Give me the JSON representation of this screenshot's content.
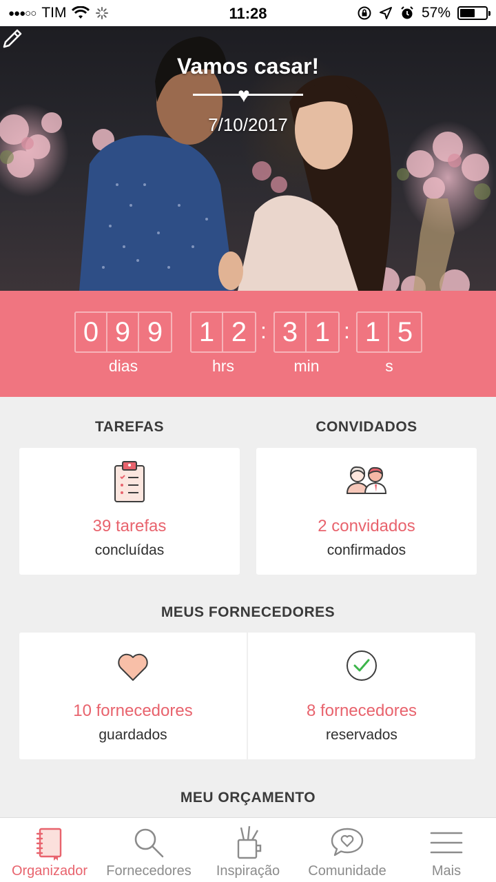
{
  "status_bar": {
    "signal": "●●●○○",
    "carrier": "TIM",
    "time": "11:28",
    "battery_percent": "57%",
    "battery_level": 0.57
  },
  "hero": {
    "title": "Vamos casar!",
    "date": "7/10/2017",
    "edit_icon": "pencil-icon"
  },
  "countdown": {
    "days": [
      "0",
      "9",
      "9"
    ],
    "hours": [
      "1",
      "2"
    ],
    "minutes": [
      "3",
      "1"
    ],
    "seconds": [
      "1",
      "5"
    ],
    "separator": ":",
    "labels": {
      "days": "dias",
      "hours": "hrs",
      "minutes": "min",
      "seconds": "s"
    },
    "background": "#f07580"
  },
  "tasks": {
    "title": "TAREFAS",
    "main": "39 tarefas",
    "sub": "concluídas",
    "icon": "clipboard-icon"
  },
  "guests": {
    "title": "CONVIDADOS",
    "main": "2 convidados",
    "sub": "confirmados",
    "icon": "people-icon"
  },
  "vendors": {
    "title": "MEUS FORNECEDORES",
    "saved": {
      "main": "10 fornecedores",
      "sub": "guardados",
      "icon": "heart-icon"
    },
    "booked": {
      "main": "8 fornecedores",
      "sub": "reservados",
      "icon": "check-circle-icon"
    }
  },
  "budget": {
    "title": "MEU ORÇAMENTO"
  },
  "tab_bar": {
    "items": [
      {
        "label": "Organizador",
        "icon": "notebook-icon",
        "active": true
      },
      {
        "label": "Fornecedores",
        "icon": "search-icon",
        "active": false
      },
      {
        "label": "Inspiração",
        "icon": "brushes-icon",
        "active": false
      },
      {
        "label": "Comunidade",
        "icon": "chat-heart-icon",
        "active": false
      },
      {
        "label": "Mais",
        "icon": "menu-icon",
        "active": false
      }
    ]
  },
  "colors": {
    "accent": "#e8636d",
    "pink": "#f07580",
    "background": "#efefef"
  }
}
